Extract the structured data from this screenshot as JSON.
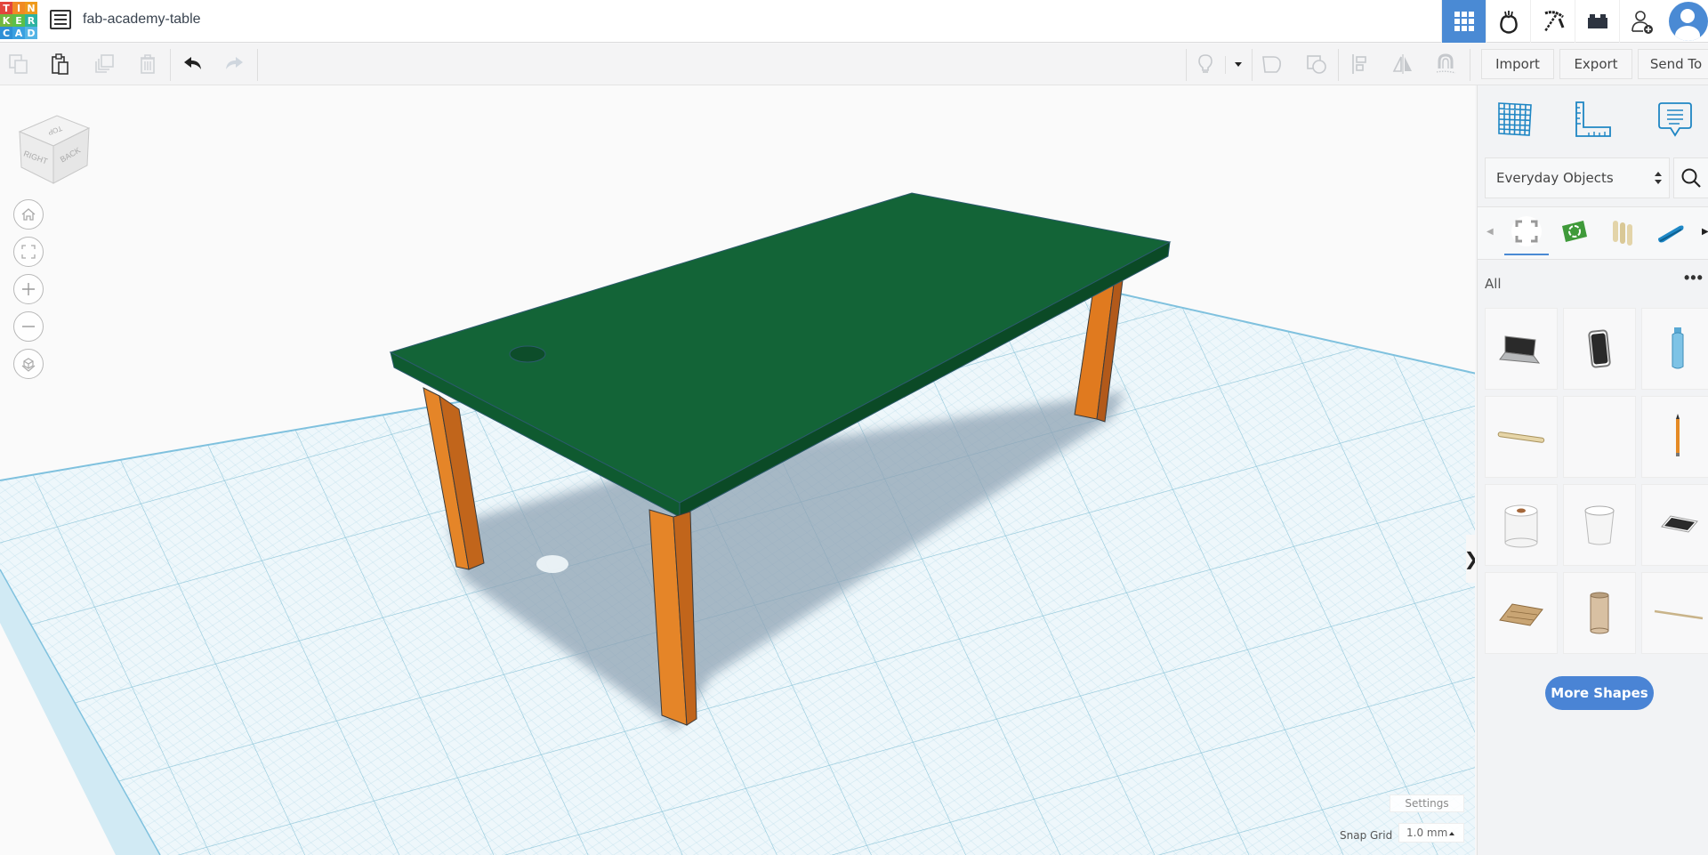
{
  "app": {
    "name": "Tinkercad",
    "logo_letters": [
      "T",
      "I",
      "N",
      "K",
      "E",
      "R",
      "C",
      "A",
      "D"
    ],
    "logo_colors": [
      "#e2453c",
      "#f08a24",
      "#ef9a1c",
      "#71b73f",
      "#5bbf48",
      "#2db3a0",
      "#2d8fd6",
      "#3aa0e0",
      "#54b4e5"
    ],
    "document_title": "fab-academy-table"
  },
  "header": {
    "buttons": [
      {
        "name": "3d-design-view",
        "icon": "grid-icon",
        "active": true
      },
      {
        "name": "circuits",
        "icon": "bag-icon",
        "active": false
      },
      {
        "name": "minecraft-blocks",
        "icon": "pickaxe-icon",
        "active": false
      },
      {
        "name": "lego-bricks",
        "icon": "brick-icon",
        "active": false
      },
      {
        "name": "share",
        "icon": "add-user-icon",
        "active": false
      },
      {
        "name": "profile",
        "icon": "avatar-icon",
        "active": false
      }
    ]
  },
  "toolbar": {
    "left": [
      {
        "name": "copy",
        "icon": "copy-icon",
        "enabled": false
      },
      {
        "name": "paste",
        "icon": "paste-icon",
        "enabled": true
      },
      {
        "name": "duplicate",
        "icon": "duplicate-icon",
        "enabled": false
      },
      {
        "name": "delete",
        "icon": "trash-icon",
        "enabled": false
      },
      {
        "name": "undo",
        "icon": "undo-icon",
        "enabled": true
      },
      {
        "name": "redo",
        "icon": "redo-icon",
        "enabled": false
      }
    ],
    "right": [
      {
        "name": "notes",
        "icon": "lightbulb-icon"
      },
      {
        "name": "notes-dropdown",
        "icon": "caret-down-icon"
      },
      {
        "name": "group",
        "icon": "group-icon"
      },
      {
        "name": "ungroup",
        "icon": "ungroup-icon"
      },
      {
        "name": "align",
        "icon": "align-icon"
      },
      {
        "name": "mirror",
        "icon": "mirror-icon"
      },
      {
        "name": "cruise",
        "icon": "magnet-icon"
      }
    ],
    "import_label": "Import",
    "export_label": "Export",
    "send_to_label": "Send To"
  },
  "viewcube": {
    "faces": {
      "top": "TOP",
      "right": "RIGHT",
      "back": "BACK"
    }
  },
  "nav_controls": [
    {
      "name": "home-view",
      "icon": "home-icon"
    },
    {
      "name": "fit-view",
      "icon": "fit-icon"
    },
    {
      "name": "zoom-in",
      "icon": "plus-icon"
    },
    {
      "name": "zoom-out",
      "icon": "minus-icon"
    },
    {
      "name": "projection",
      "icon": "perspective-icon"
    }
  ],
  "workplane": {
    "settings_label": "Settings",
    "snap_grid_label": "Snap Grid",
    "snap_grid_value": "1.0 mm"
  },
  "scene": {
    "objects": [
      {
        "name": "table-top",
        "color": "#136437",
        "has_hole": true
      },
      {
        "name": "leg-front-left",
        "color": "#e07a1f"
      },
      {
        "name": "leg-front-right",
        "color": "#e07a1f"
      },
      {
        "name": "leg-back-right",
        "color": "#e07a1f"
      }
    ]
  },
  "panel": {
    "tools": [
      {
        "name": "workplane",
        "icon": "workplane-icon"
      },
      {
        "name": "ruler",
        "icon": "ruler-icon"
      },
      {
        "name": "notes",
        "icon": "note-icon"
      }
    ],
    "library_selected": "Everyday Objects",
    "categories": [
      {
        "name": "all",
        "icon": "all-shapes-icon",
        "active": true
      },
      {
        "name": "recycling",
        "icon": "recycle-icon",
        "active": false
      },
      {
        "name": "dowels",
        "icon": "dowels-icon",
        "active": false
      },
      {
        "name": "stapler",
        "icon": "stapler-icon",
        "active": false
      }
    ],
    "section_label": "All",
    "more_label": "•••",
    "shapes": [
      {
        "name": "laptop"
      },
      {
        "name": "smartphone"
      },
      {
        "name": "water-bottle"
      },
      {
        "name": "popsicle-stick"
      },
      {
        "name": "empty"
      },
      {
        "name": "pencil"
      },
      {
        "name": "toilet-paper-roll"
      },
      {
        "name": "paper-cup"
      },
      {
        "name": "tablet"
      },
      {
        "name": "cork-board"
      },
      {
        "name": "cardboard-tube"
      },
      {
        "name": "skewer"
      }
    ],
    "more_shapes_label": "More Shapes",
    "accent_color": "#4a84d5"
  }
}
